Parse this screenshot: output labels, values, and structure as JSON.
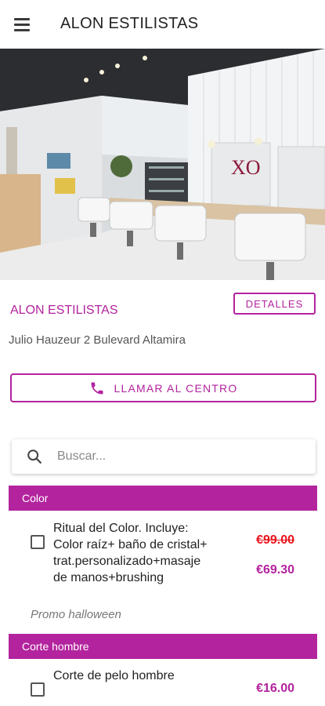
{
  "header": {
    "title": "ALON ESTILISTAS",
    "menu_icon": "hamburger-menu-icon"
  },
  "salon": {
    "name": "ALON ESTILISTAS",
    "details_label": "DETALLES",
    "address": "Julio Hauzeur 2 Bulevard Altamira",
    "call_label": "LLAMAR AL CENTRO",
    "call_icon": "phone-icon"
  },
  "search": {
    "placeholder": "Buscar...",
    "value": "",
    "icon": "search-icon"
  },
  "categories": [
    {
      "name": "Color",
      "services": [
        {
          "name": "Ritual del Color. Incluye: Color raíz+ baño de cristal+ trat.personalizado+masaje de manos+brushing",
          "old_price": "€99.00",
          "price": "€69.30",
          "promo": "Promo halloween"
        }
      ]
    },
    {
      "name": "Corte hombre",
      "services": [
        {
          "name": "Corte de pelo hombre",
          "price": "€16.00"
        }
      ]
    }
  ],
  "colors": {
    "accent": "#b3239e",
    "strike_price": "#e8141c"
  }
}
